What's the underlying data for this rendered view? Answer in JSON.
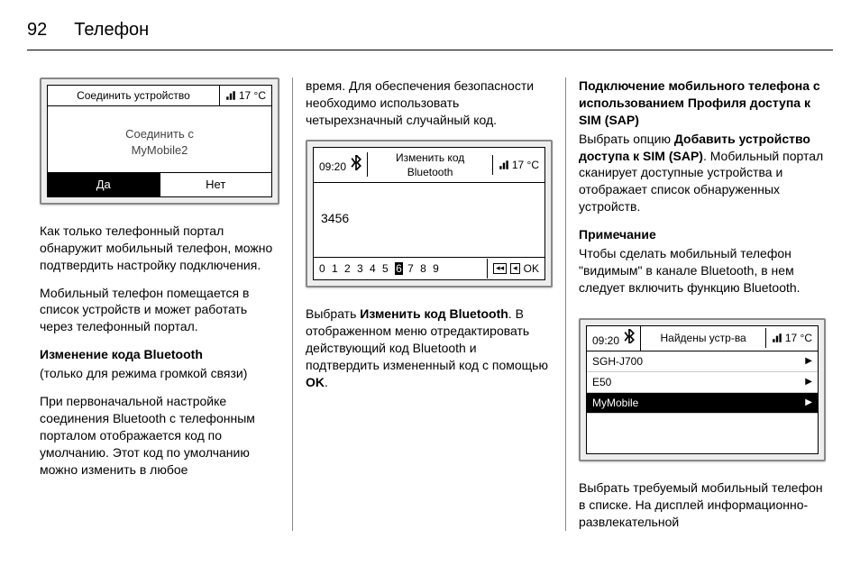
{
  "page": {
    "number": "92",
    "title": "Телефон"
  },
  "col1": {
    "dev": {
      "title": "Соединить устройство",
      "temp": "17 °C",
      "line1": "Соединить с",
      "line2": "MyMobile2",
      "yes": "Да",
      "no": "Нет"
    },
    "p1": "Как только телефонный портал обнаружит мобильный телефон, можно подтвердить настройку подключения.",
    "p2": "Мобильный телефон помещается в список устройств и может работать через телефонный портал.",
    "h1": "Изменение кода Bluetooth",
    "p3": "(только для режима громкой связи)",
    "p4": "При первоначальной настройке соединения Bluetooth с телефонным порталом отображается код по умолчанию. Этот код по умолчанию можно изменить в любое"
  },
  "col2": {
    "p1": "время. Для обеспечения безопасности необходимо использовать четырехзначный случайный код.",
    "dev": {
      "time": "09:20",
      "title": "Изменить код Bluetooth",
      "temp": "17 °C",
      "code": "3456",
      "digits_a": "0 1 2 3 4 5",
      "digits_hl": "6",
      "digits_b": "7 8 9",
      "ok": "OK"
    },
    "p2a": "Выбрать ",
    "p2b": "Изменить код Bluetooth",
    "p2c": ". В отображенном меню отредактировать действующий код Bluetooth и подтвердить измененный код с помощью ",
    "p2d": "OK",
    "p2e": "."
  },
  "col3": {
    "h1": "Подключение мобильного телефона с использованием Профиля доступа к SIM (SAP)",
    "p1a": "Выбрать опцию ",
    "p1b": "Добавить устройство доступа к SIM (SAP)",
    "p1c": ". Мобильный портал сканирует доступные устройства и отображает список обнаруженных устройств.",
    "noteh": "Примечание",
    "note": "Чтобы сделать мобильный телефон \"видимым\" в канале Bluetooth, в нем следует включить функцию Bluetooth.",
    "dev": {
      "time": "09:20",
      "title": "Найдены устр-ва",
      "temp": "17 °C",
      "items": [
        "SGH-J700",
        "E50",
        "MyMobile"
      ]
    },
    "p2": "Выбрать требуемый мобильный телефон в списке. На дисплей информационно-развлекательной"
  }
}
